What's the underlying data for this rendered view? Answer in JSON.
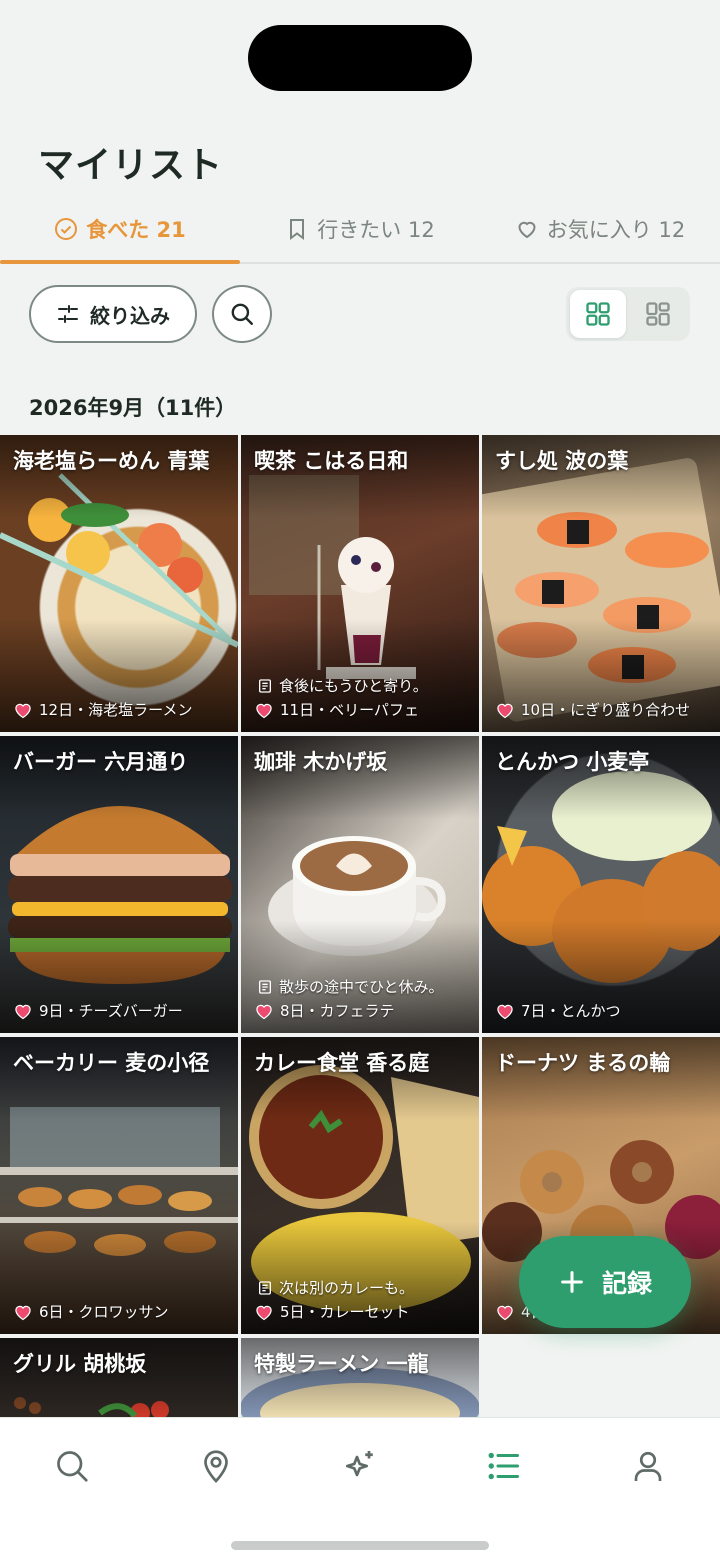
{
  "header": {
    "title": "マイリスト"
  },
  "tabs": [
    {
      "label": "食べた 21",
      "icon": "check-circle-icon",
      "active": true
    },
    {
      "label": "行きたい 12",
      "icon": "bookmark-icon",
      "active": false
    },
    {
      "label": "お気に入り 12",
      "icon": "heart-outline-icon",
      "active": false
    }
  ],
  "toolbar": {
    "filter_label": "絞り込み",
    "view_modes": [
      "grid-large",
      "grid-small"
    ],
    "selected_view": "grid-large"
  },
  "section": {
    "month_label": "2026年9月（11件）"
  },
  "cards": [
    {
      "name": "海老塩らーめん 青葉",
      "memo": "",
      "meta": "12日・海老塩ラーメン"
    },
    {
      "name": "喫茶 こはる日和",
      "memo": "食後にもうひと寄り。",
      "meta": "11日・ベリーパフェ"
    },
    {
      "name": "すし処 波の葉",
      "memo": "",
      "meta": "10日・にぎり盛り合わせ"
    },
    {
      "name": "バーガー 六月通り",
      "memo": "",
      "meta": "9日・チーズバーガー"
    },
    {
      "name": "珈琲 木かげ坂",
      "memo": "散歩の途中でひと休み。",
      "meta": "8日・カフェラテ"
    },
    {
      "name": "とんかつ 小麦亭",
      "memo": "",
      "meta": "7日・とんかつ"
    },
    {
      "name": "ベーカリー 麦の小径",
      "memo": "",
      "meta": "6日・クロワッサン"
    },
    {
      "name": "カレー食堂 香る庭",
      "memo": "次は別のカレーも。",
      "meta": "5日・カレーセット"
    },
    {
      "name": "ドーナツ まるの輪",
      "memo": "",
      "meta": "4日・ドーナツ"
    },
    {
      "name": "グリル 胡桃坂",
      "memo": "",
      "meta": ""
    },
    {
      "name": "特製ラーメン 一龍",
      "memo": "",
      "meta": ""
    }
  ],
  "fab": {
    "label": "記録"
  },
  "bottom_nav": [
    {
      "name": "search",
      "icon": "search-icon",
      "active": false
    },
    {
      "name": "map",
      "icon": "map-pin-icon",
      "active": false
    },
    {
      "name": "discover",
      "icon": "sparkle-icon",
      "active": false
    },
    {
      "name": "list",
      "icon": "list-icon",
      "active": true
    },
    {
      "name": "profile",
      "icon": "user-icon",
      "active": false
    }
  ],
  "colors": {
    "accent": "#e8963c",
    "primary": "#2e9e6e",
    "background": "#f0f3f1",
    "heart": "#ec4a6f"
  }
}
